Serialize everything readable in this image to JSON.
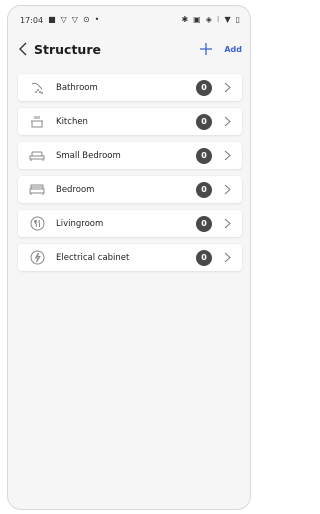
{
  "status_bar": {
    "time": "17:04",
    "left_glyphs": [
      "■",
      "▽",
      "▽",
      "⊙",
      "•"
    ],
    "right_glyphs": [
      "✱",
      "▣",
      "◈",
      "⁝",
      "▼",
      "▯"
    ]
  },
  "header": {
    "title": "Structure",
    "add_label": "Add"
  },
  "rooms": [
    {
      "label": "Bathroom",
      "count": "0",
      "icon": "shower-icon"
    },
    {
      "label": "Kitchen",
      "count": "0",
      "icon": "pot-icon"
    },
    {
      "label": "Small Bedroom",
      "count": "0",
      "icon": "small-bed-icon"
    },
    {
      "label": "Bedroom",
      "count": "0",
      "icon": "bed-icon"
    },
    {
      "label": "Livingroom",
      "count": "0",
      "icon": "dining-icon"
    },
    {
      "label": "Electrical cabinet",
      "count": "0",
      "icon": "bolt-icon"
    }
  ],
  "colors": {
    "accent": "#3d62d6",
    "badge": "#4a4a4a"
  }
}
